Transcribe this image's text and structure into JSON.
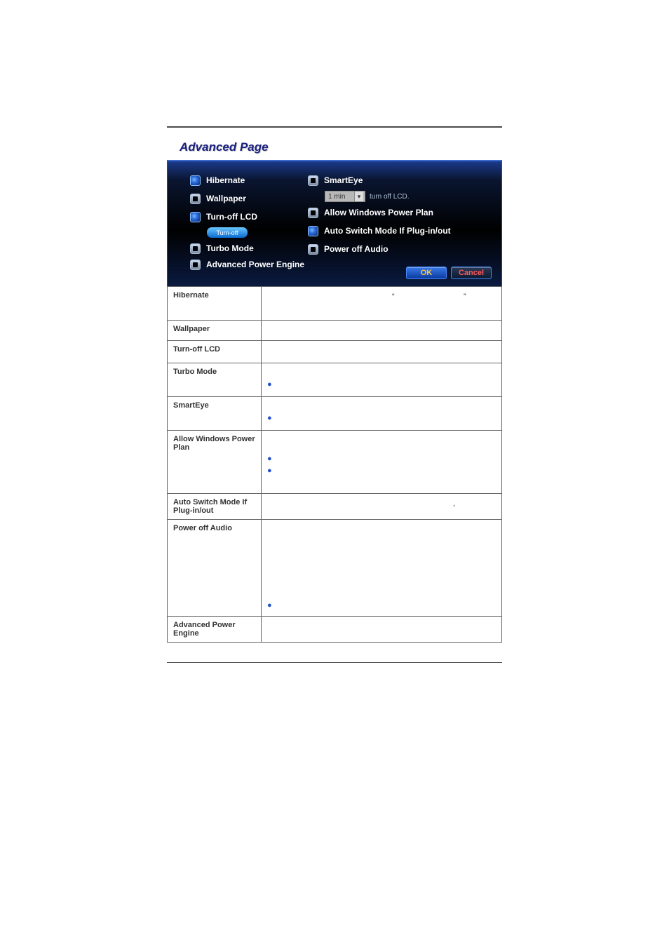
{
  "heading": "Advanced Page",
  "panel": {
    "left": [
      {
        "label": "Hibernate",
        "checked": true
      },
      {
        "label": "Wallpaper",
        "checked": false
      },
      {
        "label": "Turn-off LCD",
        "checked": true
      },
      {
        "label": "Turbo Mode",
        "checked": false
      }
    ],
    "turnoff_btn": "Turn-off",
    "right": [
      {
        "label": "SmartEye",
        "checked": false
      },
      {
        "label": "Allow Windows Power Plan",
        "checked": false
      },
      {
        "label": "Auto Switch Mode If Plug-in/out",
        "checked": true
      },
      {
        "label": "Power off Audio",
        "checked": false
      }
    ],
    "dropdown_value": "1 min",
    "dropdown_suffix": "turn off LCD.",
    "advanced_engine": {
      "label": "Advanced Power Engine",
      "checked": false
    },
    "ok": "OK",
    "cancel": "Cancel"
  },
  "table": {
    "rows": [
      {
        "name": "Hibernate",
        "quote_open": "“",
        "quote_close": "”"
      },
      {
        "name": "Wallpaper"
      },
      {
        "name": "Turn-off LCD"
      },
      {
        "name": "Turbo Mode",
        "bullets": [
          ""
        ]
      },
      {
        "name": "SmartEye",
        "bullets": [
          ""
        ]
      },
      {
        "name": "Allow Windows Power Plan",
        "bullets": [
          "",
          ""
        ]
      },
      {
        "name": "Auto Switch Mode If Plug-in/out",
        "comma": ","
      },
      {
        "name": "Power off Audio",
        "bullets": [
          ""
        ]
      },
      {
        "name": "Advanced Power Engine"
      }
    ]
  }
}
